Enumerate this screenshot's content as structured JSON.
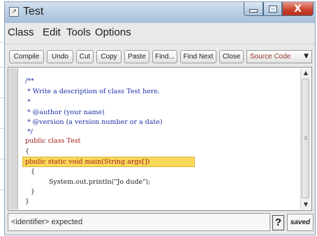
{
  "window": {
    "title": "Test",
    "close_glyph": "X"
  },
  "menu": [
    "Class",
    "Edit",
    "Tools",
    "Options"
  ],
  "toolbar": {
    "buttons": [
      "Compile",
      "Undo",
      "Cut",
      "Copy",
      "Paste",
      "Find...",
      "Find Next",
      "Close"
    ],
    "view_select": "Source Code"
  },
  "editor": {
    "lines": [
      "/**",
      " * Write a description of class Test here.",
      " *",
      " * @author (your name)",
      " * @version (a version number or a date)",
      " */",
      "public class Test",
      "{",
      "pbulic static void main(String args[])",
      "{",
      "System.out.println(\"Jo dude\");",
      "}",
      "}"
    ]
  },
  "status": {
    "message": "<identifier> expected",
    "help_label": "?",
    "state": "saved"
  },
  "colors": {
    "comment": "#1d2fa8",
    "keyword": "#a11c1c",
    "error_highlight": "#f9d95a"
  },
  "icons": [
    "window-icon",
    "minimize-icon",
    "maximize-icon",
    "close-icon",
    "scroll-up-icon",
    "scroll-down-icon",
    "dropdown-arrow-icon"
  ]
}
